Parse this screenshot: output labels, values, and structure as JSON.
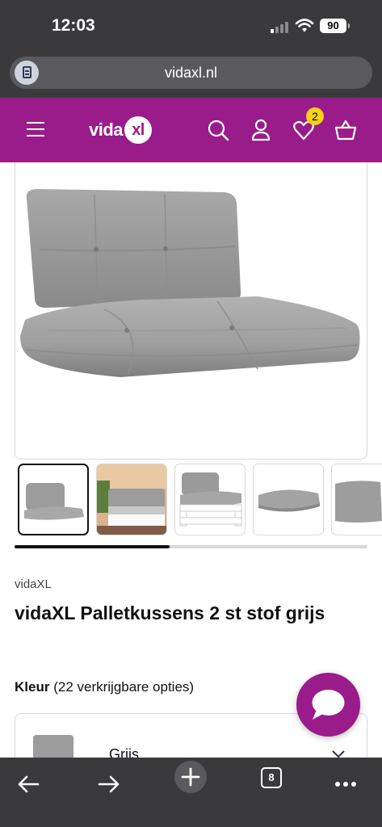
{
  "status_bar": {
    "time": "12:03",
    "battery": "90"
  },
  "browser": {
    "url": "vidaxl.nl",
    "tab_count": "8"
  },
  "header": {
    "logo_text": "vida",
    "logo_badge": "xl",
    "wishlist_count": "2",
    "brand_color": "#9a1b8a",
    "icons": [
      "menu-icon",
      "search-icon",
      "account-icon",
      "heart-icon",
      "basket-icon"
    ]
  },
  "product": {
    "brand": "vidaXL",
    "title": "vidaXL Palletkussens 2 st stof grijs",
    "gallery_progress": 0.44,
    "thumbnails": [
      "cushion-front",
      "cushion-on-pallet-outdoor",
      "cushion-on-white-pallet",
      "cushion-seat-flat",
      "cushion-back-side"
    ]
  },
  "color_selector": {
    "label": "Kleur",
    "options_text": "(22 verkrijgbare opties)",
    "selected": "Grijs"
  }
}
